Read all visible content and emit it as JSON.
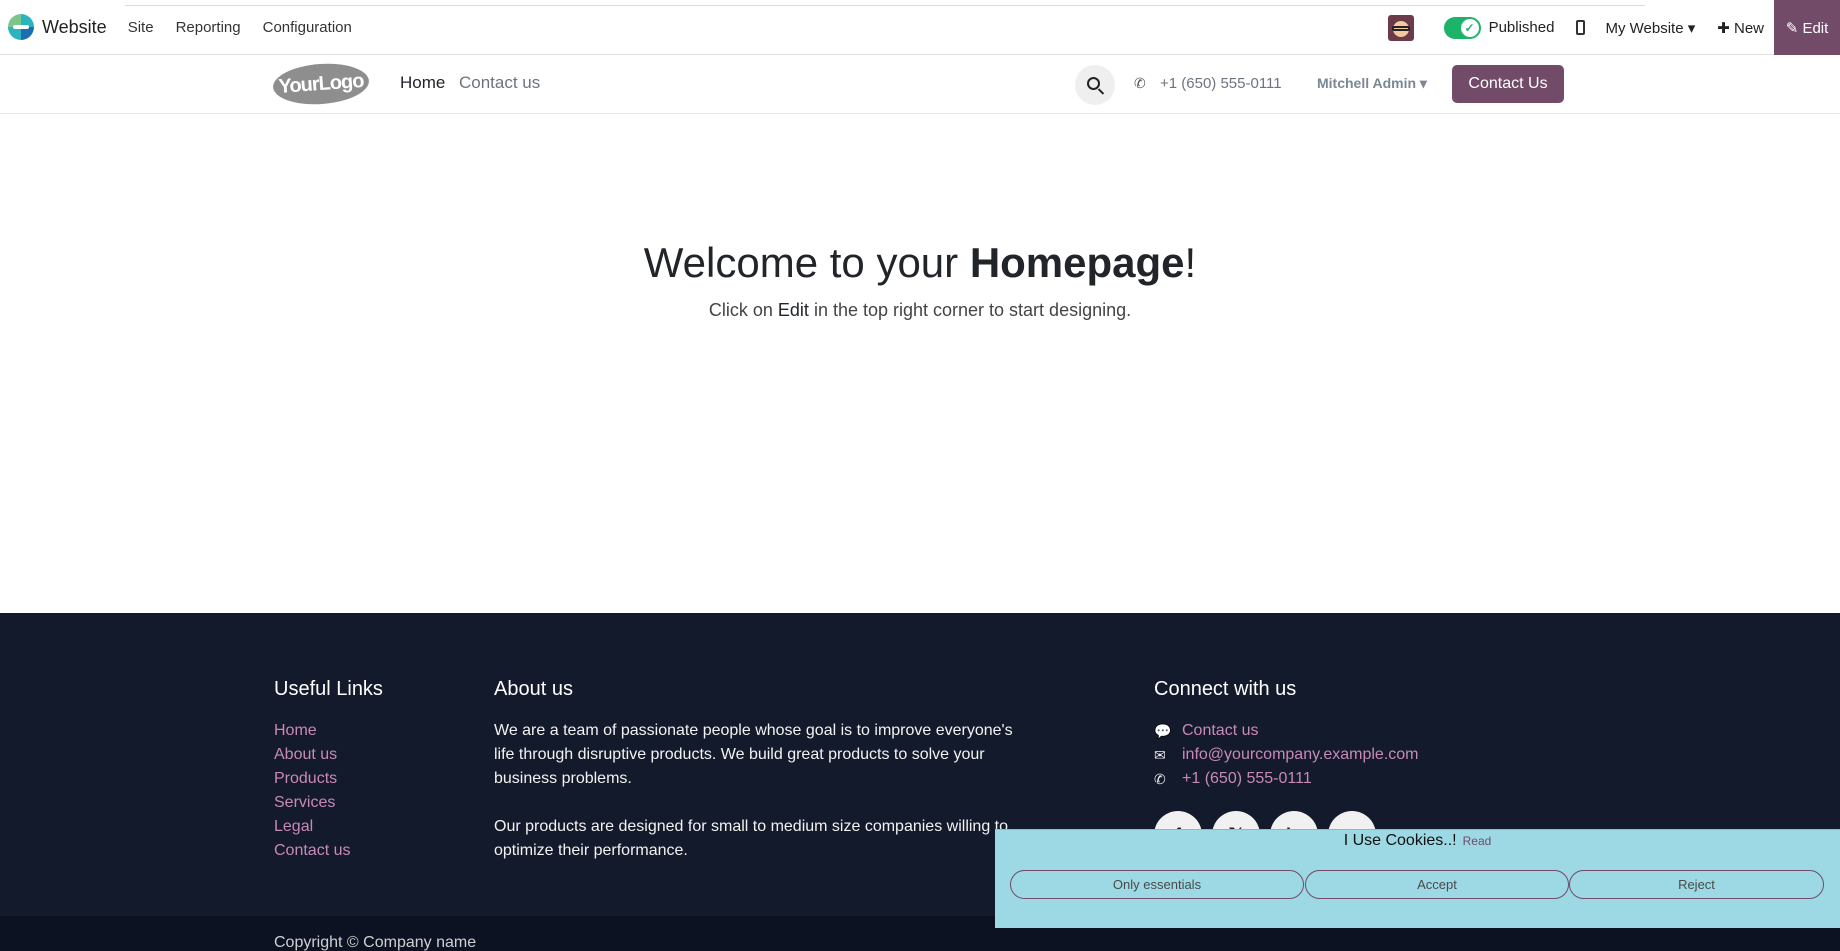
{
  "admin": {
    "app_name": "Website",
    "menu": [
      "Site",
      "Reporting",
      "Configuration"
    ],
    "published_label": "Published",
    "website_select": "My Website ▾",
    "new_label": "✚ New",
    "edit_label": "✎ Edit"
  },
  "header": {
    "logo_text": "YourLogo",
    "nav": {
      "home": "Home",
      "contact": "Contact us"
    },
    "phone": "+1 (650) 555-0111",
    "user": "Mitchell Admin ▾",
    "cta": "Contact Us"
  },
  "hero": {
    "title_prefix": "Welcome to your ",
    "title_bold": "Homepage",
    "title_suffix": "!",
    "sub_prefix": "Click on ",
    "sub_edit": "Edit",
    "sub_suffix": " in the top right corner to start designing."
  },
  "footer": {
    "links_title": "Useful Links",
    "links": [
      "Home",
      "About us",
      "Products",
      "Services",
      "Legal",
      "Contact us"
    ],
    "about_title": "About us",
    "about_p1": "We are a team of passionate people whose goal is to improve everyone's life through disruptive products. We build great products to solve your business problems.",
    "about_p2": "Our products are designed for small to medium size companies willing to optimize their performance.",
    "connect_title": "Connect with us",
    "connect": {
      "contact": "Contact us",
      "email": "info@yourcompany.example.com",
      "phone": "+1 (650) 555-0111"
    },
    "copyright": "Copyright © Company name"
  },
  "cookie": {
    "title": "I Use Cookies..!",
    "read": "Read",
    "only_essentials": "Only essentials",
    "accept": "Accept",
    "reject": "Reject"
  },
  "colors": {
    "brand": "#714b67",
    "footer_bg": "#131a2b",
    "link": "#c889b8",
    "cookie_bg": "#9dd9e4",
    "toggle_on": "#1eb36b"
  }
}
